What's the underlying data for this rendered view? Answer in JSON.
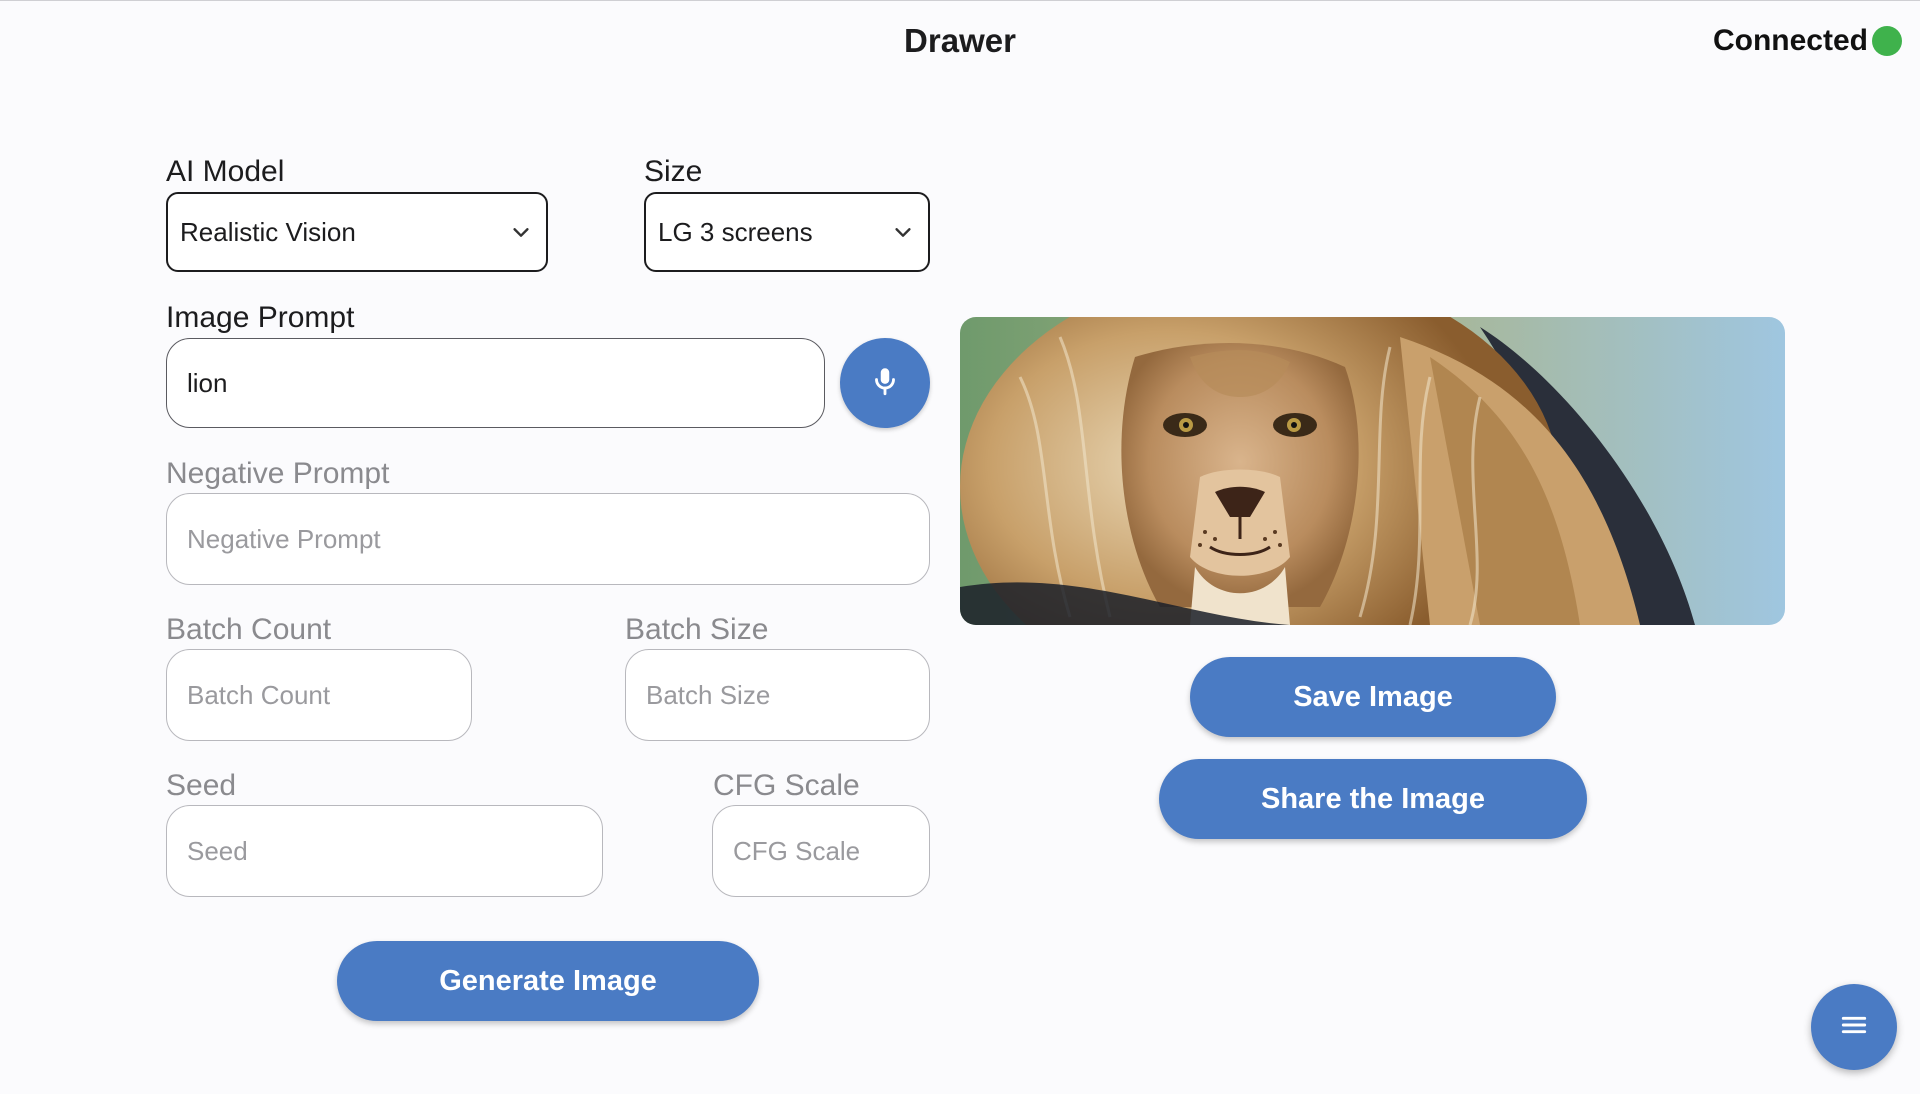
{
  "header": {
    "title": "Drawer",
    "status_label": "Connected",
    "status_color": "#3fb24c"
  },
  "form": {
    "ai_model": {
      "label": "AI Model",
      "value": "Realistic Vision"
    },
    "size": {
      "label": "Size",
      "value": "LG 3 screens"
    },
    "image_prompt": {
      "label": "Image Prompt",
      "value": "lion"
    },
    "negative_prompt": {
      "label": "Negative Prompt",
      "placeholder": "Negative Prompt"
    },
    "batch_count": {
      "label": "Batch Count",
      "placeholder": "Batch Count"
    },
    "batch_size": {
      "label": "Batch Size",
      "placeholder": "Batch Size"
    },
    "seed": {
      "label": "Seed",
      "placeholder": "Seed"
    },
    "cfg_scale": {
      "label": "CFG Scale",
      "placeholder": "CFG Scale"
    },
    "generate_label": "Generate Image"
  },
  "preview": {
    "subject": "lion",
    "save_label": "Save Image",
    "share_label": "Share the Image"
  },
  "icons": {
    "mic": "microphone-icon",
    "menu": "menu-icon",
    "chevron": "chevron-down-icon"
  },
  "theme": {
    "accent": "#4a7bc4",
    "background": "#fbfbfd"
  }
}
